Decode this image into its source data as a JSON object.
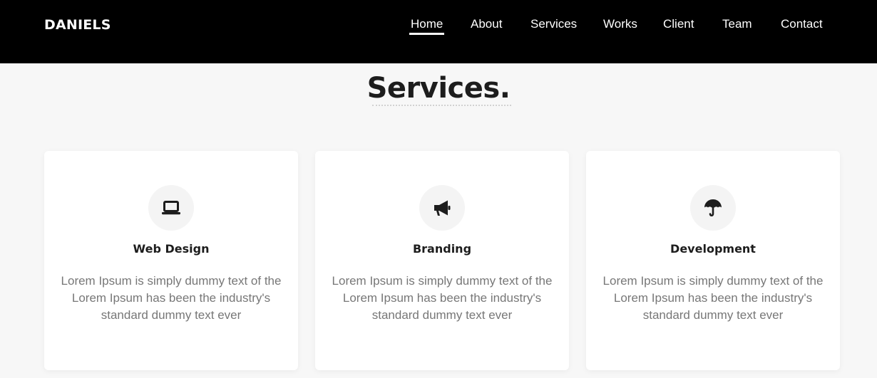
{
  "brand": "DANIELS",
  "nav": {
    "items": [
      "Home",
      "About",
      "Services",
      "Works",
      "Client",
      "Team",
      "Contact"
    ],
    "active": "Home"
  },
  "section": {
    "title": "Services."
  },
  "cards": [
    {
      "icon": "laptop-icon",
      "title": "Web Design",
      "text": "Lorem Ipsum is simply dummy text of the Lorem Ipsum has been the industry's standard dummy text ever"
    },
    {
      "icon": "megaphone-icon",
      "title": "Branding",
      "text": "Lorem Ipsum is simply dummy text of the Lorem Ipsum has been the industry's standard dummy text ever"
    },
    {
      "icon": "umbrella-icon",
      "title": "Development",
      "text": "Lorem Ipsum is simply dummy text of the Lorem Ipsum has been the industry's standard dummy text ever"
    }
  ],
  "colors": {
    "navbar_bg": "#000000",
    "page_bg": "#f7f7f7",
    "card_bg": "#ffffff",
    "icon_circle_bg": "#f4f4f4",
    "heading": "#1d1d1d",
    "body_text": "#777777"
  }
}
